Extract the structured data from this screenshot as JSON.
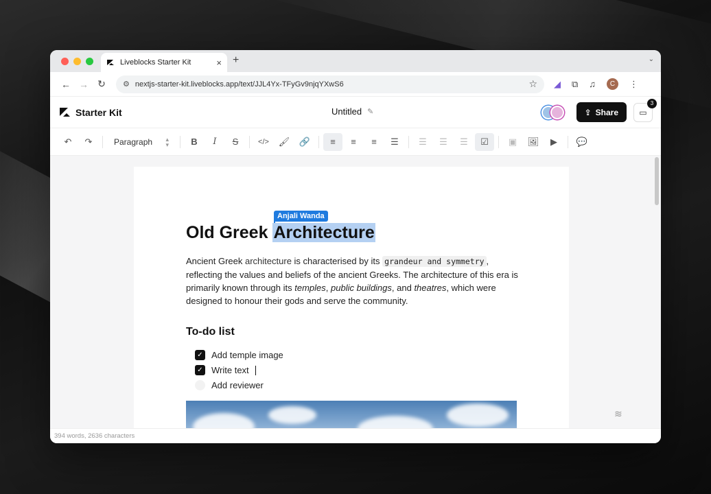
{
  "browser": {
    "tab_title": "Liveblocks Starter Kit",
    "tab_close": "×",
    "new_tab": "+",
    "tab_menu": "⌄",
    "url": "nextjs-starter-kit.liveblocks.app/text/JJL4Yx-TFyGv9njqYXwS6",
    "avatar_initial": "C"
  },
  "header": {
    "brand": "Starter Kit",
    "doc_title": "Untitled",
    "share_label": "Share",
    "inbox_count": "3"
  },
  "toolbar": {
    "block_type": "Paragraph"
  },
  "document": {
    "title_part1": "Old Greek ",
    "title_selected": "Architecture",
    "collaborator_name": "Anjali Wanda",
    "para": {
      "t1": "Ancient Greek ",
      "t2": "architecture",
      "t3": " is characterised by its ",
      "code": "grandeur and symmetry",
      "t4": ", reflecting the values and beliefs of the ancient Greeks. The architecture of this era is primarily known through its ",
      "i1": "temples",
      "t5": ", ",
      "i2": "public buildings",
      "t6": ", and ",
      "i3": "theatres",
      "t7": ", which were designed to honour their gods and serve the community."
    },
    "todo_heading": "To-do list",
    "todos": [
      {
        "label": "Add temple image",
        "checked": true
      },
      {
        "label": "Write text",
        "checked": true
      },
      {
        "label": "Add reviewer",
        "checked": false
      }
    ]
  },
  "status": {
    "counts": "394 words, 2636 characters"
  }
}
